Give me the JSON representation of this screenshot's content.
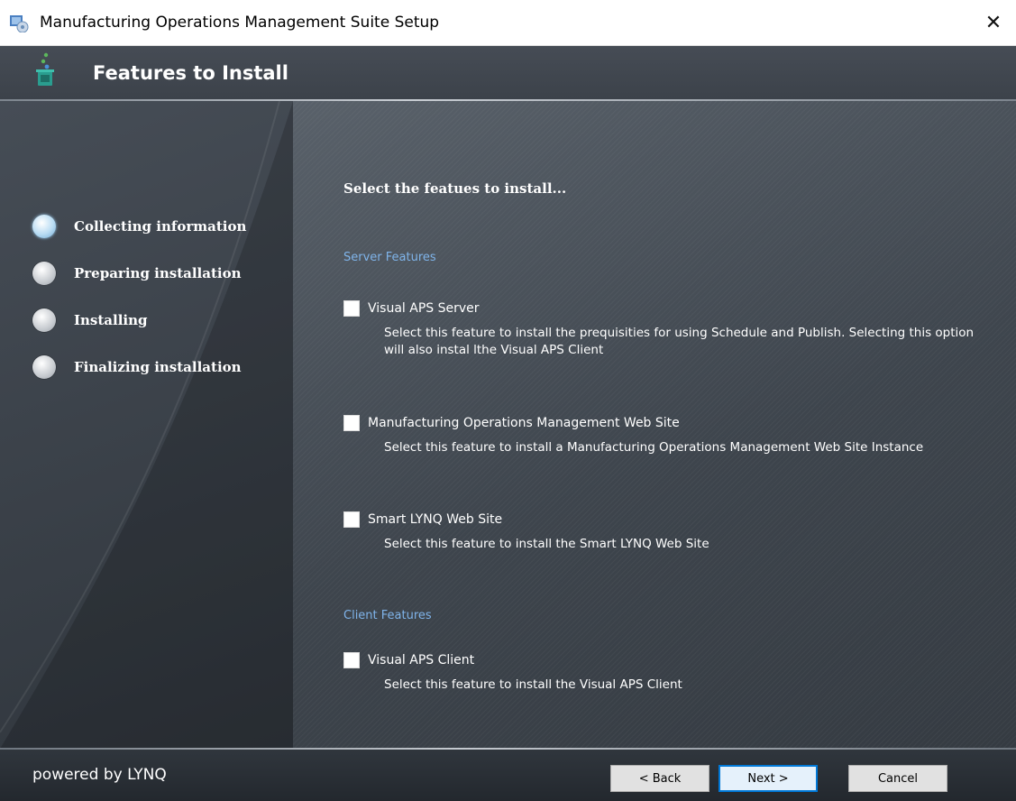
{
  "window": {
    "title": "Manufacturing Operations Management Suite Setup",
    "close_label": "✕"
  },
  "header": {
    "title": "Features to Install"
  },
  "steps": [
    {
      "label": "Collecting information",
      "active": true
    },
    {
      "label": "Preparing installation",
      "active": false
    },
    {
      "label": "Installing",
      "active": false
    },
    {
      "label": "Finalizing installation",
      "active": false
    }
  ],
  "content": {
    "intro": "Select the featues to install...",
    "server_section": "Server Features",
    "client_section": "Client Features",
    "features": [
      {
        "name": "Visual APS Server",
        "description": "Select this feature to install the prequisities for using Schedule and Publish. Selecting this option will also instal lthe Visual APS Client",
        "checked": false
      },
      {
        "name": "Manufacturing Operations Management Web Site",
        "description": "Select this feature to install a Manufacturing Operations Management Web Site Instance",
        "checked": false
      },
      {
        "name": "Smart LYNQ Web Site",
        "description": "Select this feature to install the Smart LYNQ Web Site",
        "checked": false
      },
      {
        "name": "Visual APS Client",
        "description": "Select this feature to install the Visual APS Client",
        "checked": false
      }
    ]
  },
  "footer": {
    "brand": "powered by LYNQ",
    "back_label": "< Back",
    "next_label": "Next >",
    "cancel_label": "Cancel"
  },
  "colors": {
    "section_heading": "#7fb4ea",
    "default_button_border": "#0078d7",
    "panel_background": "#434a53"
  }
}
